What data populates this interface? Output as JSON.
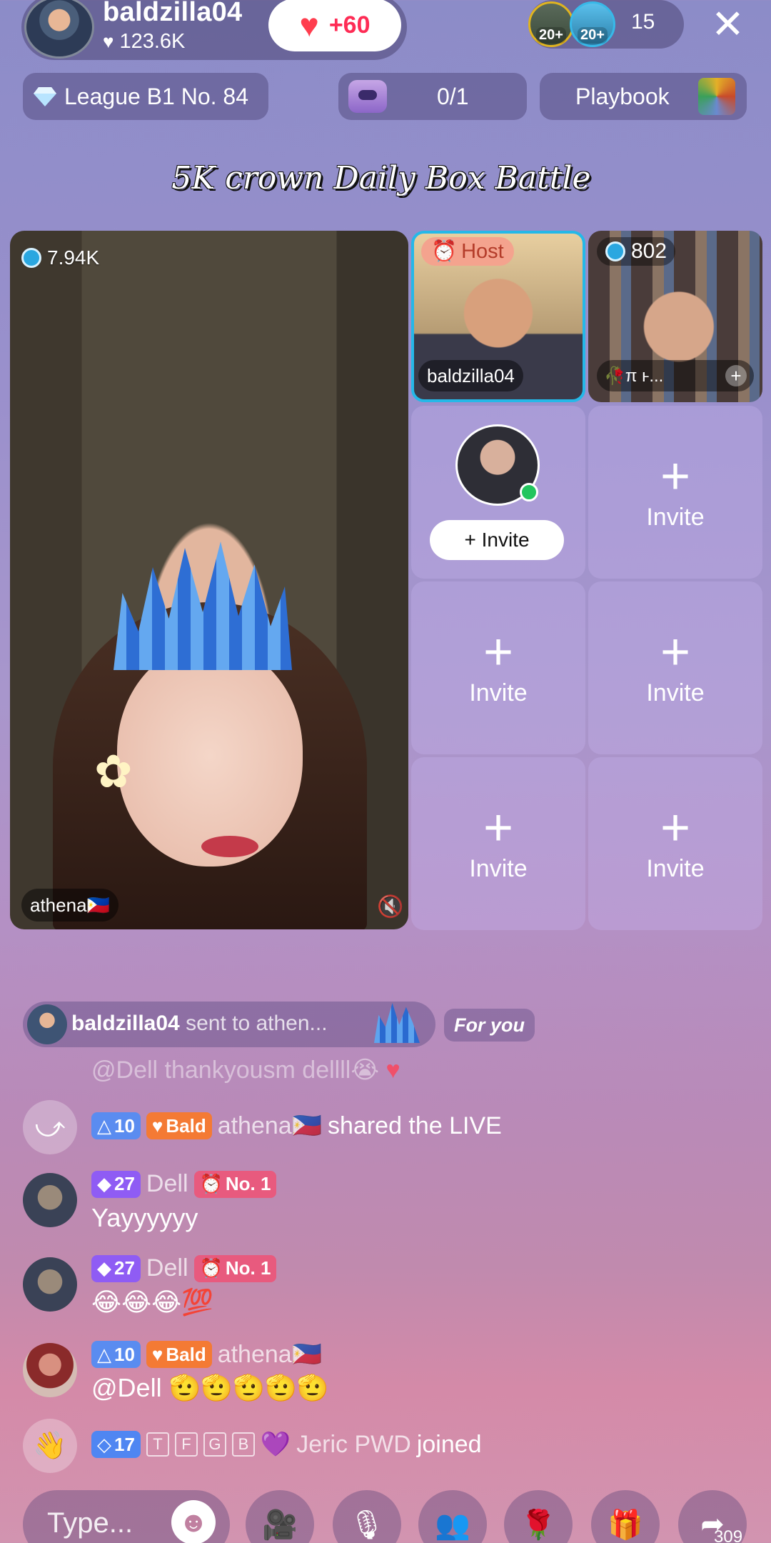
{
  "header": {
    "host_name": "baldzilla04",
    "host_likes": "123.6K",
    "like_badge": "+60",
    "viewer_badges": [
      "20+",
      "20+"
    ],
    "viewer_count": "15",
    "close_icon": "close-icon"
  },
  "chips": {
    "league": "League B1 No. 84",
    "quest_progress": "0/1",
    "playbook": "Playbook"
  },
  "battle_title": "5K crown Daily Box Battle",
  "grid": {
    "main": {
      "score": "7.94K",
      "name": "athena🇵🇭"
    },
    "host": {
      "badge": "Host",
      "name": "baldzilla04"
    },
    "guest2": {
      "score": "802",
      "name": "🥀π ⱶ..."
    },
    "waiting_invite": "+ Invite",
    "slot_plus": "+",
    "slot_label": "Invite"
  },
  "chat": {
    "gift": {
      "sender": "baldzilla04",
      "text": "sent to athen...",
      "for_you": "For you"
    },
    "faded": "@Dell thankyousm dellll😭",
    "messages": [
      {
        "level": "10",
        "fan": "Bald",
        "user": "athena🇵🇭",
        "text": "shared the LIVE"
      },
      {
        "level": "27",
        "fan": "No. 1",
        "user": "Dell",
        "text": "Yayyyyyy"
      },
      {
        "level": "27",
        "fan": "No. 1",
        "user": "Dell",
        "text": "😂😂😂💯"
      },
      {
        "level": "10",
        "fan": "Bald",
        "user": "athena🇵🇭",
        "text": "@Dell 🫡🫡🫡🫡🫡"
      },
      {
        "level": "17",
        "tags": [
          "T",
          "F",
          "G",
          "B"
        ],
        "user": "Jeric PWD",
        "text": "joined"
      }
    ]
  },
  "bottom_bar": {
    "placeholder": "Type...",
    "share_count": "309"
  }
}
